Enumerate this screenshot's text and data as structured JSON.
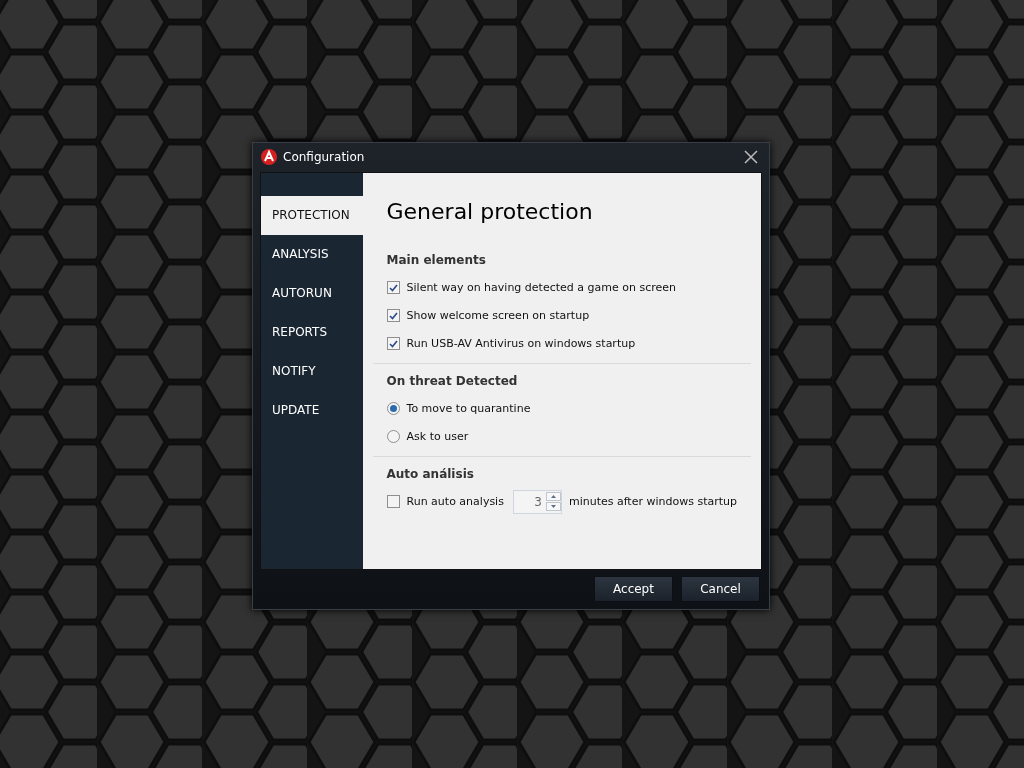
{
  "window": {
    "title": "Configuration"
  },
  "sidebar": {
    "items": [
      {
        "label": "PROTECTION",
        "selected": true
      },
      {
        "label": "ANALYSIS",
        "selected": false
      },
      {
        "label": "AUTORUN",
        "selected": false
      },
      {
        "label": "REPORTS",
        "selected": false
      },
      {
        "label": "NOTIFY",
        "selected": false
      },
      {
        "label": "UPDATE",
        "selected": false
      }
    ]
  },
  "heading": "General protection",
  "sections": [
    {
      "title": "Main elements",
      "options": [
        {
          "kind": "checkbox",
          "label": "Silent way on having detected a game on screen",
          "checked": true
        },
        {
          "kind": "checkbox",
          "label": "Show welcome screen on startup",
          "checked": true
        },
        {
          "kind": "checkbox",
          "label": "Run USB-AV Antivirus on windows startup",
          "checked": true
        }
      ]
    },
    {
      "title": "On threat Detected",
      "options": [
        {
          "kind": "radio",
          "label": "To move to quarantine",
          "selected": true
        },
        {
          "kind": "radio",
          "label": "Ask to user",
          "selected": false
        }
      ]
    },
    {
      "title": "Auto análisis",
      "options": [
        {
          "kind": "checkbox-spinner",
          "label": "Run auto analysis",
          "checked": false,
          "value": "3",
          "suffix": "minutes after windows startup"
        }
      ]
    }
  ],
  "buttons": [
    "Accept",
    "Cancel"
  ]
}
